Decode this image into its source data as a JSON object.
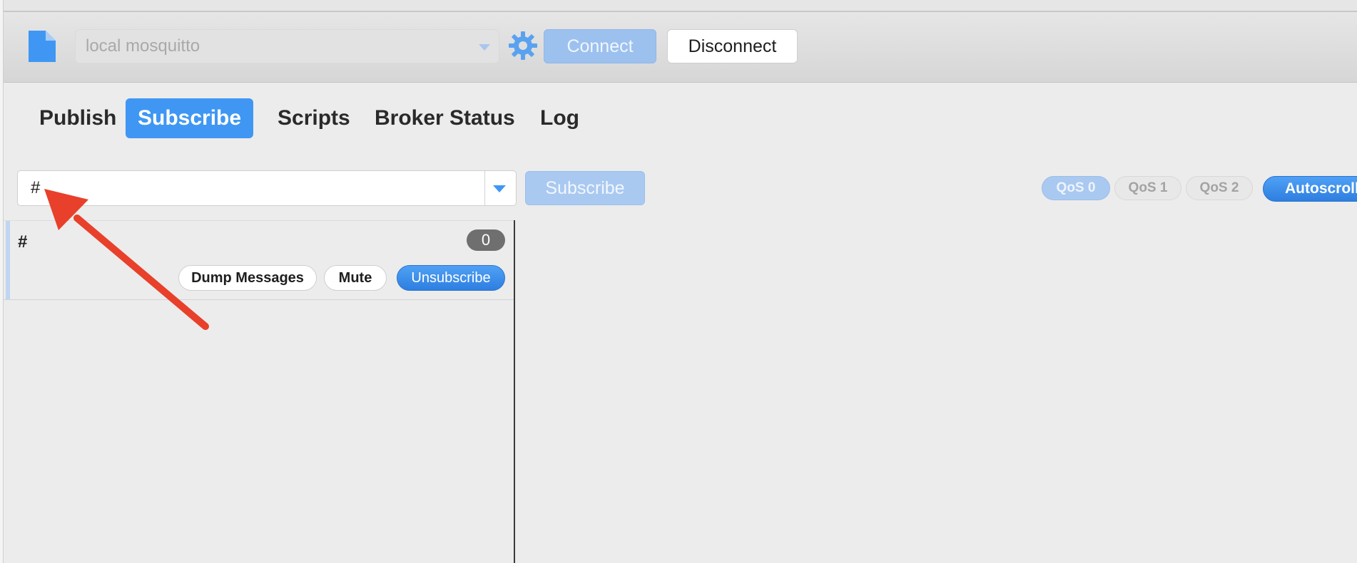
{
  "connection": {
    "profile": "local mosquitto",
    "connect_label": "Connect",
    "disconnect_label": "Disconnect"
  },
  "tabs": [
    {
      "label": "Publish",
      "active": false
    },
    {
      "label": "Subscribe",
      "active": true
    },
    {
      "label": "Scripts",
      "active": false
    },
    {
      "label": "Broker Status",
      "active": false
    },
    {
      "label": "Log",
      "active": false
    }
  ],
  "subscribe": {
    "topic_value": "#",
    "subscribe_label": "Subscribe",
    "qos": [
      {
        "label": "QoS 0",
        "selected": true
      },
      {
        "label": "QoS 1",
        "selected": false
      },
      {
        "label": "QoS 2",
        "selected": false
      }
    ],
    "autoscroll_label": "Autoscroll"
  },
  "subscriptions": [
    {
      "topic": "#",
      "message_count": "0",
      "dump_label": "Dump Messages",
      "mute_label": "Mute",
      "unsubscribe_label": "Unsubscribe"
    }
  ],
  "colors": {
    "accent": "#3f97f3",
    "annotation_arrow": "#e8402a"
  },
  "icons": {
    "profile": "document-icon",
    "settings": "gear-icon"
  }
}
